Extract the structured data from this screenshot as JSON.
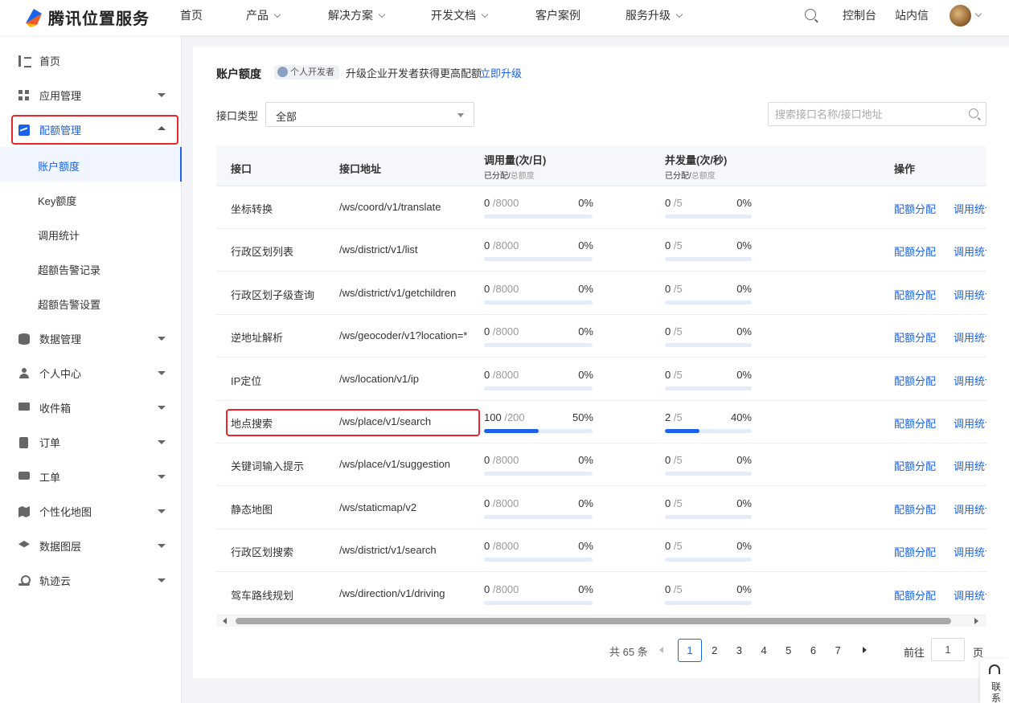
{
  "header": {
    "brand": "腾讯位置服务",
    "nav": [
      {
        "label": "首页",
        "dropdown": false
      },
      {
        "label": "产品",
        "dropdown": true
      },
      {
        "label": "解决方案",
        "dropdown": true
      },
      {
        "label": "开发文档",
        "dropdown": true
      },
      {
        "label": "客户案例",
        "dropdown": false
      },
      {
        "label": "服务升级",
        "dropdown": true
      }
    ],
    "console": "控制台",
    "inbox": "站内信"
  },
  "sidebar": {
    "items": [
      {
        "label": "首页",
        "icon": "list-icon"
      },
      {
        "label": "应用管理",
        "icon": "grid-icon"
      },
      {
        "label": "配额管理",
        "icon": "quota-icon"
      },
      {
        "label": "数据管理",
        "icon": "database-icon"
      },
      {
        "label": "个人中心",
        "icon": "user-icon"
      },
      {
        "label": "收件箱",
        "icon": "mail-icon"
      },
      {
        "label": "订单",
        "icon": "order-icon"
      },
      {
        "label": "工单",
        "icon": "ticket-icon"
      },
      {
        "label": "个性化地图",
        "icon": "map-icon"
      },
      {
        "label": "数据图层",
        "icon": "layers-icon"
      },
      {
        "label": "轨迹云",
        "icon": "track-icon"
      }
    ],
    "sub": [
      "账户额度",
      "Key额度",
      "调用统计",
      "超额告警记录",
      "超额告警设置"
    ],
    "active_sub": "账户额度"
  },
  "account": {
    "title": "账户额度",
    "badge": "个人开发者",
    "tip": "升级企业开发者获得更高配额",
    "upgrade_link": "立即升级"
  },
  "filter": {
    "label": "接口类型",
    "value": "全部",
    "search_placeholder": "搜索接口名称/接口地址"
  },
  "table": {
    "headers": {
      "api": "接口",
      "path": "接口地址",
      "daily": "调用量(次/日)",
      "qps": "并发量(次/秒)",
      "sub_allocated": "已分配/",
      "sub_total": "总额度",
      "ops": "操作"
    },
    "rows": [
      {
        "name": "坐标转换",
        "path": "/ws/coord/v1/translate",
        "daily_used": "0",
        "daily_total": "/8000",
        "daily_pct": "0%",
        "daily_fill": 0,
        "qps_used": "0",
        "qps_total": "/5",
        "qps_pct": "0%",
        "qps_fill": 0
      },
      {
        "name": "行政区划列表",
        "path": "/ws/district/v1/list",
        "daily_used": "0",
        "daily_total": "/8000",
        "daily_pct": "0%",
        "daily_fill": 0,
        "qps_used": "0",
        "qps_total": "/5",
        "qps_pct": "0%",
        "qps_fill": 0
      },
      {
        "name": "行政区划子级查询",
        "path": "/ws/district/v1/getchildren",
        "daily_used": "0",
        "daily_total": "/8000",
        "daily_pct": "0%",
        "daily_fill": 0,
        "qps_used": "0",
        "qps_total": "/5",
        "qps_pct": "0%",
        "qps_fill": 0
      },
      {
        "name": "逆地址解析",
        "path": "/ws/geocoder/v1?location=*",
        "daily_used": "0",
        "daily_total": "/8000",
        "daily_pct": "0%",
        "daily_fill": 0,
        "qps_used": "0",
        "qps_total": "/5",
        "qps_pct": "0%",
        "qps_fill": 0
      },
      {
        "name": "IP定位",
        "path": "/ws/location/v1/ip",
        "daily_used": "0",
        "daily_total": "/8000",
        "daily_pct": "0%",
        "daily_fill": 0,
        "qps_used": "0",
        "qps_total": "/5",
        "qps_pct": "0%",
        "qps_fill": 0
      },
      {
        "name": "地点搜索",
        "path": "/ws/place/v1/search",
        "daily_used": "100",
        "daily_total": "/200",
        "daily_pct": "50%",
        "daily_fill": 50,
        "qps_used": "2",
        "qps_total": "/5",
        "qps_pct": "40%",
        "qps_fill": 40
      },
      {
        "name": "关键词输入提示",
        "path": "/ws/place/v1/suggestion",
        "daily_used": "0",
        "daily_total": "/8000",
        "daily_pct": "0%",
        "daily_fill": 0,
        "qps_used": "0",
        "qps_total": "/5",
        "qps_pct": "0%",
        "qps_fill": 0
      },
      {
        "name": "静态地图",
        "path": "/ws/staticmap/v2",
        "daily_used": "0",
        "daily_total": "/8000",
        "daily_pct": "0%",
        "daily_fill": 0,
        "qps_used": "0",
        "qps_total": "/5",
        "qps_pct": "0%",
        "qps_fill": 0
      },
      {
        "name": "行政区划搜索",
        "path": "/ws/district/v1/search",
        "daily_used": "0",
        "daily_total": "/8000",
        "daily_pct": "0%",
        "daily_fill": 0,
        "qps_used": "0",
        "qps_total": "/5",
        "qps_pct": "0%",
        "qps_fill": 0
      },
      {
        "name": "驾车路线规划",
        "path": "/ws/direction/v1/driving",
        "daily_used": "0",
        "daily_total": "/8000",
        "daily_pct": "0%",
        "daily_fill": 0,
        "qps_used": "0",
        "qps_total": "/5",
        "qps_pct": "0%",
        "qps_fill": 0
      }
    ],
    "op_quota": "配额分配",
    "op_stats": "调用统计"
  },
  "pagination": {
    "total": "共 65 条",
    "pages": [
      "1",
      "2",
      "3",
      "4",
      "5",
      "6",
      "7"
    ],
    "current": "1",
    "goto": "前往",
    "goto_value": "1",
    "page_suffix": "页"
  },
  "contact": "联系",
  "colors": {
    "accent": "#1a63e8",
    "highlight": "#e8262b"
  }
}
